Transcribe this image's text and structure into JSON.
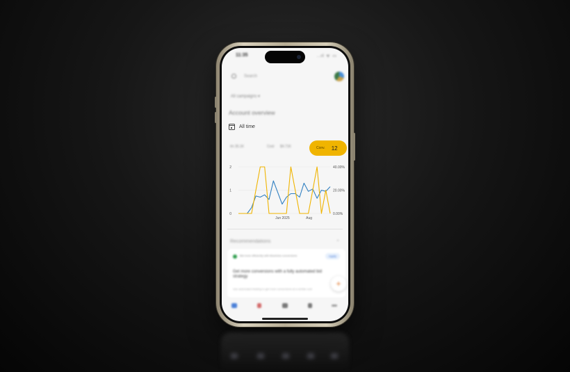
{
  "colors": {
    "accent": "#f0b400",
    "series_clicks": "#2f7fc1",
    "series_conv_rate": "#f0b400",
    "background": "#0d0d0d"
  },
  "status_bar": {
    "time": "11:35",
    "icons": "..ıl ᯤ ▭"
  },
  "search": {
    "placeholder": "Search"
  },
  "campaign_filter": {
    "label": "All campaigns ▾"
  },
  "overview": {
    "title": "Account overview"
  },
  "date_range": {
    "label": "All time"
  },
  "metrics": {
    "faded_left": "Im 35.1K",
    "faded_mid": "Cost",
    "faded_right": "$4.71K",
    "selected_label": "Conv.",
    "selected_value": "12"
  },
  "chart_data": {
    "type": "line",
    "x_tick_labels": [
      "Jun 2025",
      "Aug"
    ],
    "y_left_ticks": [
      "0",
      "1",
      "2"
    ],
    "y_right_ticks": [
      "0.00%",
      "20.00%",
      "40.00%"
    ],
    "y_left_range": [
      0,
      2
    ],
    "y_right_range": [
      0,
      40
    ],
    "grid": true,
    "series": [
      {
        "axis": "left",
        "color": "#2f7fc1",
        "values": [
          0,
          0,
          0,
          0.25,
          0.75,
          0.7,
          0.8,
          0.6,
          1.4,
          0.9,
          0.4,
          0.7,
          0.85,
          0.85,
          0.7,
          1.3,
          0.95,
          1.05,
          0.65,
          1.0,
          0.95,
          1.15
        ]
      },
      {
        "axis": "right",
        "color": "#f0b400",
        "values": [
          0,
          0,
          0,
          0,
          20,
          40,
          40,
          0,
          0,
          0,
          0,
          0,
          40,
          20,
          0,
          0,
          0,
          20,
          40,
          0,
          20,
          0
        ]
      }
    ]
  },
  "recommendations": {
    "title": "Recommendations",
    "chip_text": "Bid more efficiently with Maximize conversions",
    "apply_label": "Apply",
    "headline": "Get more conversions with a fully automated bid strategy",
    "subtext": "Use automated bidding to get more conversions at a similar cost"
  },
  "fab": {
    "icon": "plus-icon"
  },
  "nav": {
    "items": [
      "home-icon",
      "campaigns-icon",
      "insights-icon",
      "account-icon",
      "more-icon"
    ]
  }
}
